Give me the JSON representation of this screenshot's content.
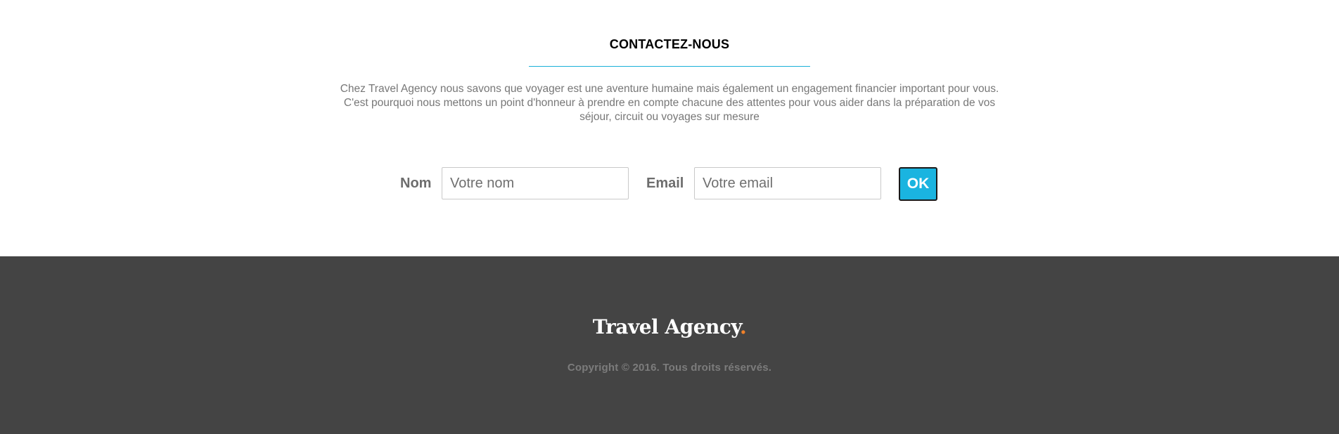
{
  "contact": {
    "title": "CONTACTEZ-NOUS",
    "description_lines": [
      "Chez Travel Agency nous savons que voyager est une aventure humaine mais également un engagement financier important pour vous.",
      "C'est pourquoi nous mettons un point d'honneur à prendre en compte chacune des attentes pour vous aider dans la préparation de vos",
      "séjour, circuit ou voyages sur mesure"
    ],
    "form": {
      "name_label": "Nom",
      "name_placeholder": "Votre nom",
      "name_value": "",
      "email_label": "Email",
      "email_placeholder": "Votre email",
      "email_value": "",
      "submit_label": "OK"
    }
  },
  "footer": {
    "logo_text": "Travel Agency",
    "logo_dot": ".",
    "copyright": "Copyright © 2016. Tous droits réservés."
  },
  "colors": {
    "accent": "#1ab4e0",
    "footer_bg": "#444444",
    "logo_dot": "#f0812a"
  }
}
